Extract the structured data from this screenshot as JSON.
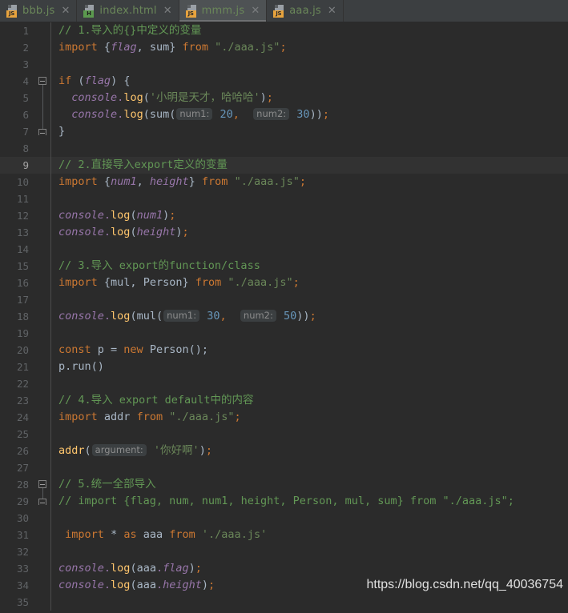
{
  "window": {
    "theme": "darcula",
    "colors": {
      "editor_background": "#2b2b2b",
      "tabbar_background": "#3c3f41",
      "active_tab_background": "#4e5254",
      "current_line_background": "#323232",
      "gutter_text": "#606366",
      "comment": "#629755",
      "keyword": "#cc7832",
      "string": "#6a8759",
      "number": "#6897bb",
      "function": "#ffc66d",
      "identifier_italic": "#9876aa",
      "plain_text": "#a9b7c6",
      "hint_chip_background": "#3b3f41",
      "hint_chip_text": "#8c8c8c",
      "js_badge": "#e8a33d",
      "html_badge": "#5b9a4e"
    }
  },
  "tabs": [
    {
      "label": "bbb.js",
      "icon": "javascript-file-icon",
      "badge": "JS",
      "badge_type": "js",
      "active": false,
      "closable": true
    },
    {
      "label": "index.html",
      "icon": "html-file-icon",
      "badge": "H",
      "badge_type": "html",
      "active": false,
      "closable": true
    },
    {
      "label": "mmm.js",
      "icon": "javascript-file-icon",
      "badge": "JS",
      "badge_type": "js",
      "active": true,
      "closable": true
    },
    {
      "label": "aaa.js",
      "icon": "javascript-file-icon",
      "badge": "JS",
      "badge_type": "js",
      "active": false,
      "closable": true
    }
  ],
  "tab_close_glyph": "✕",
  "editor": {
    "current_line": 9,
    "first_line": 1,
    "last_line": 35,
    "lines": [
      {
        "n": 1,
        "fold": "none"
      },
      {
        "n": 2,
        "fold": "none"
      },
      {
        "n": 3,
        "fold": "none"
      },
      {
        "n": 4,
        "fold": "start"
      },
      {
        "n": 5,
        "fold": "mid"
      },
      {
        "n": 6,
        "fold": "mid"
      },
      {
        "n": 7,
        "fold": "end"
      },
      {
        "n": 8,
        "fold": "none"
      },
      {
        "n": 9,
        "fold": "none"
      },
      {
        "n": 10,
        "fold": "none"
      },
      {
        "n": 11,
        "fold": "none"
      },
      {
        "n": 12,
        "fold": "none"
      },
      {
        "n": 13,
        "fold": "none"
      },
      {
        "n": 14,
        "fold": "none"
      },
      {
        "n": 15,
        "fold": "none"
      },
      {
        "n": 16,
        "fold": "none"
      },
      {
        "n": 17,
        "fold": "none"
      },
      {
        "n": 18,
        "fold": "none"
      },
      {
        "n": 19,
        "fold": "none"
      },
      {
        "n": 20,
        "fold": "none"
      },
      {
        "n": 21,
        "fold": "none"
      },
      {
        "n": 22,
        "fold": "none"
      },
      {
        "n": 23,
        "fold": "none"
      },
      {
        "n": 24,
        "fold": "none"
      },
      {
        "n": 25,
        "fold": "none"
      },
      {
        "n": 26,
        "fold": "none"
      },
      {
        "n": 27,
        "fold": "none"
      },
      {
        "n": 28,
        "fold": "start"
      },
      {
        "n": 29,
        "fold": "end"
      },
      {
        "n": 30,
        "fold": "none"
      },
      {
        "n": 31,
        "fold": "none"
      },
      {
        "n": 32,
        "fold": "none"
      },
      {
        "n": 33,
        "fold": "none"
      },
      {
        "n": 34,
        "fold": "none"
      },
      {
        "n": 35,
        "fold": "none"
      }
    ],
    "code": [
      {
        "n": 1,
        "text": "// 1.导入的{}中定义的变量"
      },
      {
        "n": 2,
        "text": "import {flag, sum} from \"./aaa.js\";"
      },
      {
        "n": 3,
        "text": ""
      },
      {
        "n": 4,
        "text": "if (flag) {"
      },
      {
        "n": 5,
        "text": "  console.log('小明是天才，哈哈哈');"
      },
      {
        "n": 6,
        "text": "  console.log(sum( num1: 20,  num2: 30));"
      },
      {
        "n": 7,
        "text": "}"
      },
      {
        "n": 8,
        "text": ""
      },
      {
        "n": 9,
        "text": "// 2.直接导入export定义的变量"
      },
      {
        "n": 10,
        "text": "import {num1, height} from \"./aaa.js\";"
      },
      {
        "n": 11,
        "text": ""
      },
      {
        "n": 12,
        "text": "console.log(num1);"
      },
      {
        "n": 13,
        "text": "console.log(height);"
      },
      {
        "n": 14,
        "text": ""
      },
      {
        "n": 15,
        "text": "// 3.导入 export的function/class"
      },
      {
        "n": 16,
        "text": "import {mul, Person} from \"./aaa.js\";"
      },
      {
        "n": 17,
        "text": ""
      },
      {
        "n": 18,
        "text": "console.log(mul( num1: 30,  num2: 50));"
      },
      {
        "n": 19,
        "text": ""
      },
      {
        "n": 20,
        "text": "const p = new Person();"
      },
      {
        "n": 21,
        "text": "p.run()"
      },
      {
        "n": 22,
        "text": ""
      },
      {
        "n": 23,
        "text": "// 4.导入 export default中的内容"
      },
      {
        "n": 24,
        "text": "import addr from \"./aaa.js\";"
      },
      {
        "n": 25,
        "text": ""
      },
      {
        "n": 26,
        "text": "addr( argument: '你好啊');"
      },
      {
        "n": 27,
        "text": ""
      },
      {
        "n": 28,
        "text": "// 5.统一全部导入"
      },
      {
        "n": 29,
        "text": "// import {flag, num, num1, height, Person, mul, sum} from \"./aaa.js\";"
      },
      {
        "n": 30,
        "text": ""
      },
      {
        "n": 31,
        "text": "import * as aaa from './aaa.js'"
      },
      {
        "n": 32,
        "text": ""
      },
      {
        "n": 33,
        "text": "console.log(aaa.flag);"
      },
      {
        "n": 34,
        "text": "console.log(aaa.height);"
      },
      {
        "n": 35,
        "text": ""
      }
    ],
    "inlay_hints": [
      {
        "line": 6,
        "labels": [
          "num1:",
          "num2:"
        ]
      },
      {
        "line": 18,
        "labels": [
          "num1:",
          "num2:"
        ]
      },
      {
        "line": 26,
        "labels": [
          "argument:"
        ]
      }
    ]
  },
  "watermark": {
    "text": "https://blog.csdn.net/qq_40036754"
  }
}
